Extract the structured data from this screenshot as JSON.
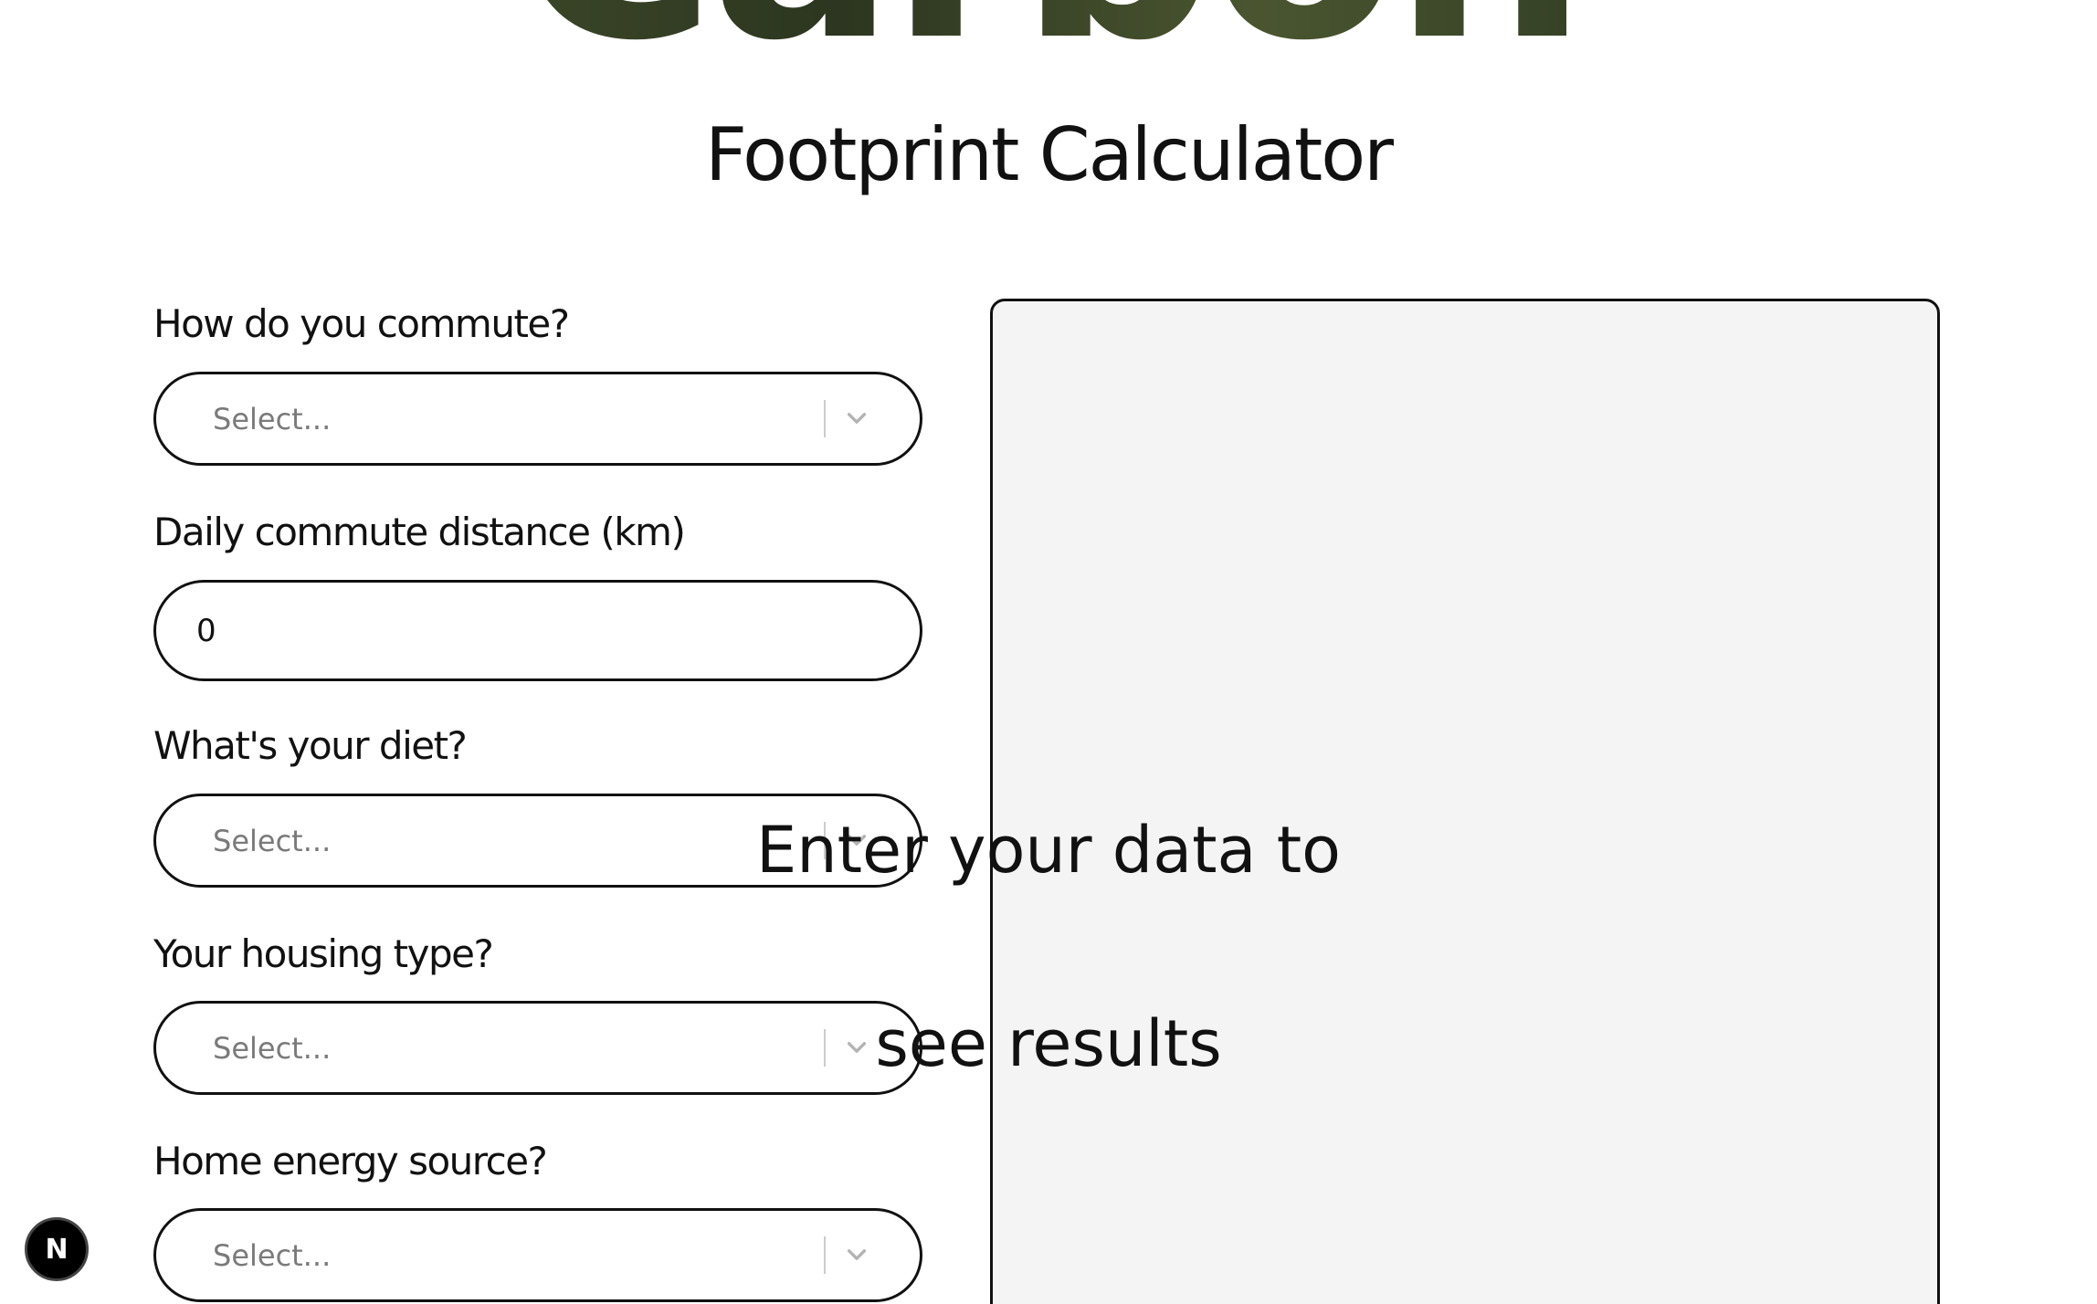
{
  "hero": {
    "word": "Carbon"
  },
  "page_title": "Footprint Calculator",
  "form": {
    "commute": {
      "label": "How do you commute?",
      "placeholder": "Select..."
    },
    "distance": {
      "label": "Daily commute distance (km)",
      "value": "0"
    },
    "diet": {
      "label": "What's your diet?",
      "placeholder": "Select..."
    },
    "housing": {
      "label": "Your housing type?",
      "placeholder": "Select..."
    },
    "energy": {
      "label": "Home energy source?",
      "placeholder": "Select..."
    }
  },
  "results": {
    "line1": "Enter your data to",
    "line2": "see results"
  },
  "dev_badge": {
    "letter": "N"
  },
  "colors": {
    "text": "#111111",
    "panel_bg": "#f4f4f4",
    "placeholder": "#7a7a7a",
    "separator": "#cccccc"
  },
  "icons": {
    "select_indicator": "chevron-down-icon",
    "dev_tools": "nextjs-logo-icon"
  }
}
